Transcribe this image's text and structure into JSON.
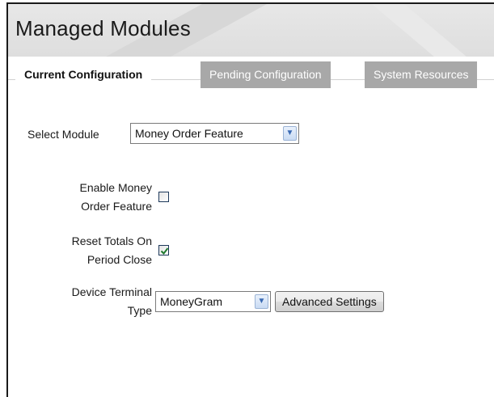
{
  "header": {
    "title": "Managed Modules"
  },
  "tabs": [
    {
      "label": "Current Configuration",
      "active": true
    },
    {
      "label": "Pending Configuration",
      "active": false
    },
    {
      "label": "System Resources",
      "active": false
    }
  ],
  "form": {
    "select_module": {
      "label": "Select Module",
      "value": "Money Order Feature"
    },
    "enable_feature": {
      "label_line1": "Enable Money",
      "label_line2": "Order Feature",
      "checked": false
    },
    "reset_totals": {
      "label_line1": "Reset Totals On",
      "label_line2": "Period Close",
      "checked": true
    },
    "device_terminal": {
      "label_line1": "Device Terminal",
      "label_line2": "Type",
      "value": "MoneyGram"
    },
    "advanced_button": {
      "label": "Advanced Settings"
    }
  },
  "icons": {
    "dropdown": "chevron-down-icon",
    "check": "checkmark-icon"
  },
  "colors": {
    "header_bg": "#dedede",
    "tab_active_bg": "#ffffff",
    "tab_inactive_bg": "#a8a8a8",
    "check_color": "#1e7a2e",
    "dropdown_accent": "#3a6ab3"
  }
}
